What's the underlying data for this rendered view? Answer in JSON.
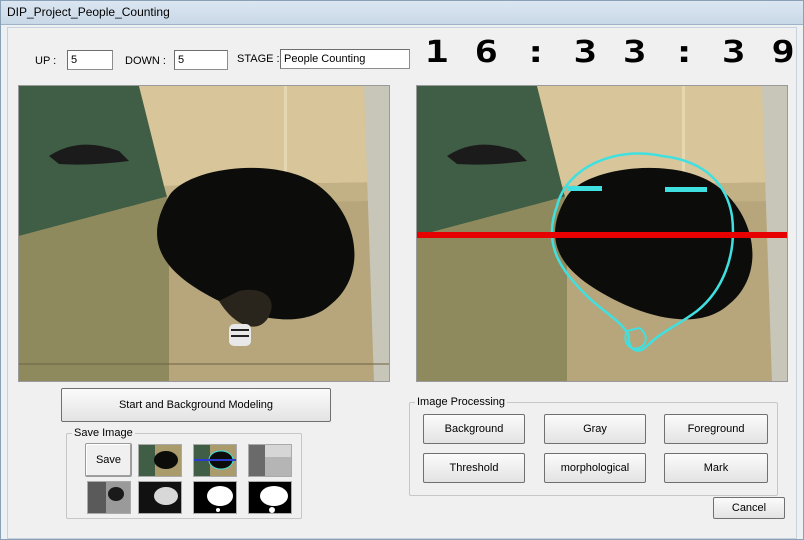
{
  "window": {
    "title": "DIP_Project_People_Counting"
  },
  "counters": {
    "up_label": "UP :",
    "up_value": "5",
    "down_label": "DOWN :",
    "down_value": "5",
    "stage_label": "STAGE :",
    "stage_value": "People Counting"
  },
  "clock": {
    "time": "16:33:39"
  },
  "buttons": {
    "start": "Start and Background Modeling",
    "save": "Save",
    "cancel": "Cancel"
  },
  "save_group": {
    "title": "Save Image"
  },
  "processing": {
    "title": "Image Processing",
    "buttons": [
      "Background",
      "Gray",
      "Foreground",
      "Threshold",
      "morphological",
      "Mark"
    ]
  },
  "colors": {
    "counting_line": "#e60000",
    "contour": "#40e0e0"
  }
}
